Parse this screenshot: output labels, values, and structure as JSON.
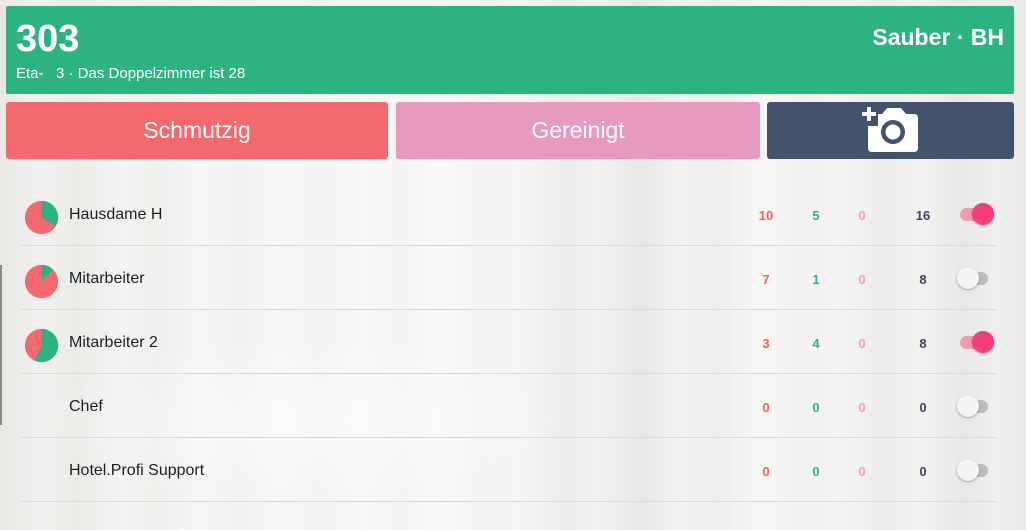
{
  "header": {
    "room_number": "303",
    "floor_text": "Eta-   3 · Das Doppelzimmer ist 28",
    "status": "Sauber · BH"
  },
  "actions": {
    "dirty_label": "Schmutzig",
    "cleaned_label": "Gereinigt",
    "camera_icon": "add-photo-icon"
  },
  "colors": {
    "header_green": "#2db382",
    "dirty_red": "#f4696d",
    "cleaned_pink": "#e899bf",
    "camera_navy": "#43536b",
    "toggle_on": "#f53d7d"
  },
  "staff": [
    {
      "name": "Hausdame  H",
      "dirty": "10",
      "clean": "5",
      "pink": "0",
      "total": "16",
      "enabled": true,
      "has_chart": true
    },
    {
      "name": "Mitarbeiter",
      "dirty": "7",
      "clean": "1",
      "pink": "0",
      "total": "8",
      "enabled": false,
      "has_chart": true
    },
    {
      "name": "Mitarbeiter 2",
      "dirty": "3",
      "clean": "4",
      "pink": "0",
      "total": "8",
      "enabled": true,
      "has_chart": true
    },
    {
      "name": "Chef",
      "dirty": "0",
      "clean": "0",
      "pink": "0",
      "total": "0",
      "enabled": false,
      "has_chart": false
    },
    {
      "name": "Hotel.Profi Support",
      "dirty": "0",
      "clean": "0",
      "pink": "0",
      "total": "0",
      "enabled": false,
      "has_chart": false
    }
  ]
}
